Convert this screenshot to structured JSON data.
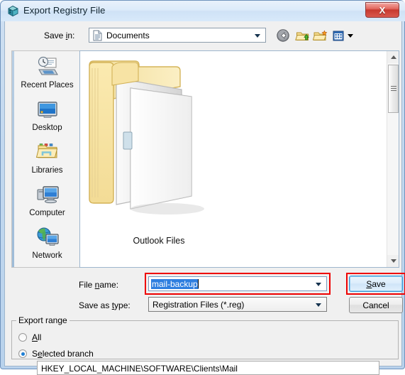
{
  "window": {
    "title": "Export Registry File",
    "title_icon": "registry-editor-icon",
    "close_label": "X"
  },
  "toolbar": {
    "save_in_label": "Save in:",
    "save_in_accel": "i",
    "save_in_value": "Documents",
    "save_in_icon": "documents-icon",
    "back_icon": "back-arrow-icon",
    "up_icon": "up-one-level-icon",
    "new_folder_icon": "new-folder-icon",
    "views_icon": "views-icon",
    "views_arrow_icon": "chevron-down-icon"
  },
  "places": [
    {
      "label": "Recent Places",
      "icon": "recent-places-icon"
    },
    {
      "label": "Desktop",
      "icon": "desktop-icon"
    },
    {
      "label": "Libraries",
      "icon": "libraries-icon"
    },
    {
      "label": "Computer",
      "icon": "computer-icon"
    },
    {
      "label": "Network",
      "icon": "network-icon"
    }
  ],
  "file_list": {
    "items": [
      {
        "name": "Outlook Files",
        "icon": "folder-open-icon"
      }
    ],
    "scrollbar": {
      "up_icon": "scroll-up-icon",
      "down_icon": "scroll-down-icon"
    }
  },
  "form": {
    "file_name_label": "File name:",
    "file_name_accel": "n",
    "file_name_value": "mail-backup",
    "file_name_dropdown_icon": "chevron-down-icon",
    "save_as_type_label": "Save as type:",
    "save_as_type_accel": "t",
    "save_as_type_value": "Registration Files (*.reg)",
    "save_as_type_dropdown_icon": "chevron-down-icon"
  },
  "buttons": {
    "save_label": "Save",
    "save_accel": "S",
    "cancel_label": "Cancel"
  },
  "export_range": {
    "group_label": "Export range",
    "options": [
      {
        "label": "All",
        "accel": "A",
        "selected": false
      },
      {
        "label": "Selected branch",
        "accel": "e",
        "selected": true
      }
    ],
    "branch_path": "HKEY_LOCAL_MACHINE\\SOFTWARE\\Clients\\Mail"
  },
  "colors": {
    "annotation_red": "#ee0000",
    "selection_blue": "#2f7fe0",
    "focus_blue": "#3c99d4",
    "title_bar": "#dcebfa",
    "close_button_red": "#c73a30"
  }
}
